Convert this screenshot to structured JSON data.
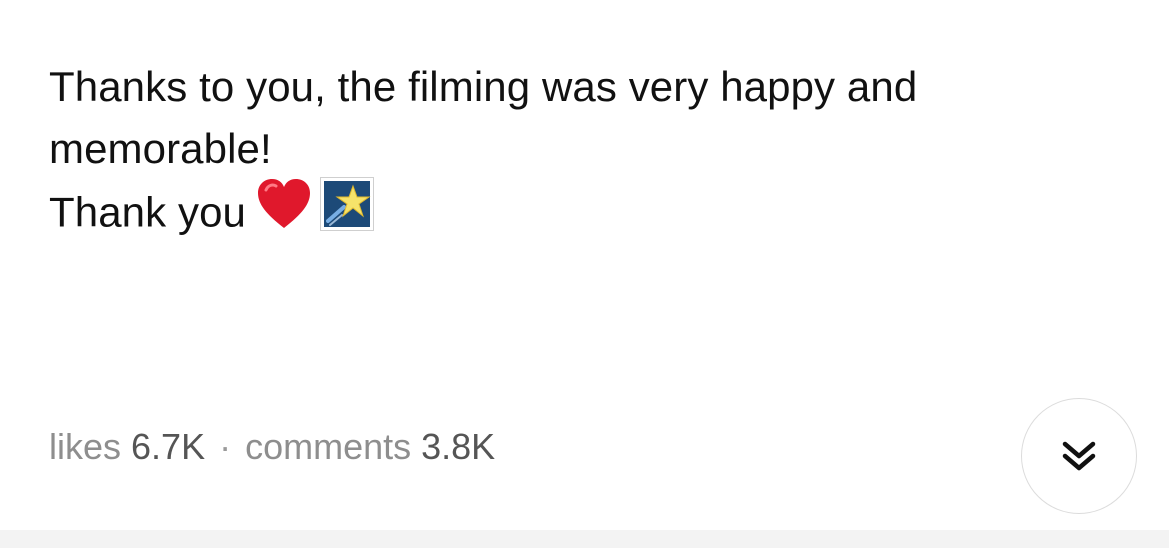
{
  "post": {
    "line1": "Thanks to you, the filming was very happy and",
    "line2": "memorable!",
    "line3": "Thank you",
    "emojis": [
      "red-heart-emoji",
      "shooting-star-emoji"
    ]
  },
  "stats": {
    "likes_label": "likes",
    "likes_value": "6.7K",
    "separator": "·",
    "comments_label": "comments",
    "comments_value": "3.8K"
  },
  "controls": {
    "expand_icon": "double-chevron-down-icon"
  },
  "colors": {
    "text": "#111111",
    "muted_label": "#8e8e8e",
    "stat_value": "#555555",
    "heart": "#e0182c",
    "star_tile_bg": "#1d4a78",
    "star": "#f6e36a",
    "button_border": "#dcdcdc",
    "bottom_bar": "#f3f3f3"
  }
}
